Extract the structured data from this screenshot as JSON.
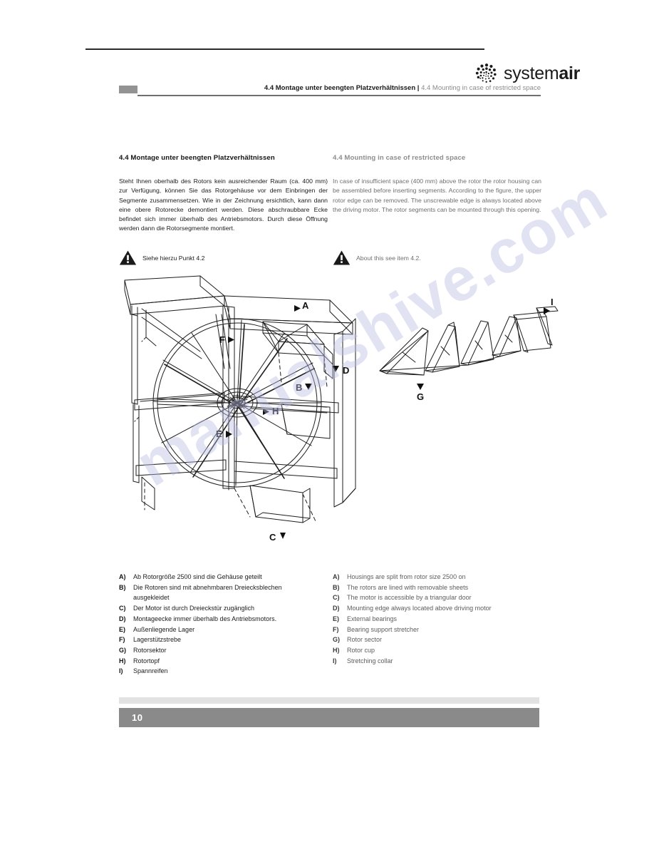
{
  "brand": {
    "logo_text_light": "system",
    "logo_text_bold": "air",
    "logo_mark_name": "systemair-spiral-logo"
  },
  "running_head": {
    "german": "4.4 Montage unter beengten Platzverhältnissen",
    "separator": " | ",
    "english": "4.4 Mounting in case of restricted space"
  },
  "section": {
    "title_de": "4.4 Montage unter beengten Platzverhältnissen",
    "title_en": "4.4 Mounting in case of restricted space",
    "body_de": "Steht Ihnen oberhalb des Rotors kein ausreichender Raum (ca. 400 mm) zur Verfügung, können Sie das Rotorgehäuse vor dem Einbringen der Segmente zusammensetzen. Wie in der Zeichnung ersichtlich, kann dann eine obere Rotorecke demontiert werden. Diese abschraubbare Ecke befindet sich immer überhalb des Antriebsmotors. Durch diese Öffnung werden dann die Rotorsegmente montiert.",
    "body_en": "In case of insufficient space (400 mm) above the rotor the rotor housing can be assembled before inserting segments. According to the figure, the upper rotor edge can be removed. The unscrewable edge is always located above the driving motor. The rotor segments can be mounted through this opening."
  },
  "notes": {
    "de": "Siehe hierzu Punkt 4.2",
    "en": "About this see item 4.2."
  },
  "figure_labels": {
    "main": [
      "A",
      "B",
      "C",
      "D",
      "E",
      "F",
      "H"
    ],
    "side": [
      "G",
      "I"
    ]
  },
  "legend_de": [
    {
      "key": "A)",
      "value": "Ab Rotorgröße 2500 sind die Gehäuse geteilt"
    },
    {
      "key": "B)",
      "value": "Die Rotoren sind mit abnehmbaren Dreiecksblechen",
      "cont": "ausgekleidet"
    },
    {
      "key": "C)",
      "value": "Der Motor ist durch Dreieckstür zugänglich"
    },
    {
      "key": "D)",
      "value": "Montageecke immer überhalb des Antriebsmotors."
    },
    {
      "key": "E)",
      "value": "Außenliegende Lager"
    },
    {
      "key": "F)",
      "value": "Lagerstützstrebe"
    },
    {
      "key": "G)",
      "value": "Rotorsektor"
    },
    {
      "key": "H)",
      "value": "Rotortopf"
    },
    {
      "key": "I)",
      "value": "Spannreifen"
    }
  ],
  "legend_en": [
    {
      "key": "A)",
      "value": "Housings are split from rotor size 2500 on"
    },
    {
      "key": "B)",
      "value": "The rotors are lined with removable sheets"
    },
    {
      "key": "C)",
      "value": "The motor is accessible by a triangular door"
    },
    {
      "key": "D)",
      "value": "Mounting edge always located above driving motor"
    },
    {
      "key": "E)",
      "value": "External bearings"
    },
    {
      "key": "F)",
      "value": "Bearing support stretcher"
    },
    {
      "key": "G)",
      "value": "Rotor sector"
    },
    {
      "key": "H)",
      "value": "Rotor cup"
    },
    {
      "key": "I)",
      "value": "Stretching collar"
    }
  ],
  "footer": {
    "page_number": "10"
  },
  "watermark": {
    "text": "manualshive.com",
    "color": "#b9bde4"
  },
  "colors": {
    "header_gray": "#8c8c8c",
    "footer_bar": "#8a8a8a",
    "footer_thin": "#e2e2e2",
    "rule": "#2b2b2b"
  }
}
